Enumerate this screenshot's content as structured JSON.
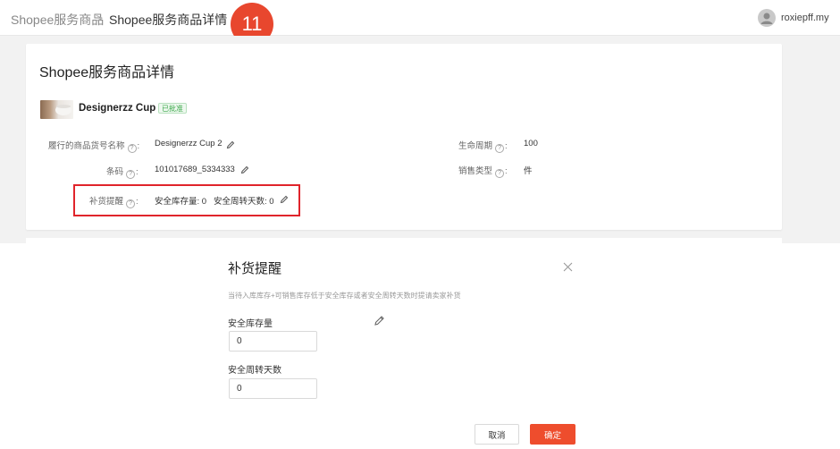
{
  "header": {
    "breadcrumb_root": "Shopee服务商品",
    "breadcrumb_sep": ">",
    "breadcrumb_current": "Shopee服务商品详情",
    "step_number": "11",
    "username": "roxiepff.my"
  },
  "card": {
    "title": "Shopee服务商品详情",
    "product_name": "Designerzz Cup 2",
    "status_badge": "已批准",
    "help_glyph": "?",
    "fields": {
      "sku_label": "履行的商品货号名称",
      "sku_value": "Designerzz Cup 2",
      "barcode_label": "条码",
      "barcode_value": "101017689_5334333",
      "restock_label": "补货提醒",
      "restock_value": "安全库存量: 0   安全周转天数: 0",
      "lifecycle_label": "生命周期",
      "lifecycle_value": "100",
      "sales_type_label": "销售类型",
      "sales_type_value": "件",
      "colon": ":"
    }
  },
  "modal": {
    "title": "补货提醒",
    "description": "当待入库库存+可销售库存低于安全库存或者安全周转天数时提请卖家补货",
    "safety_stock_label": "安全库存量",
    "safety_stock_value": "0",
    "turnover_days_label": "安全周转天数",
    "turnover_days_value": "0",
    "cancel_label": "取消",
    "confirm_label": "确定"
  },
  "colors": {
    "accent": "#ee4d2d",
    "highlight": "#e0242b",
    "approved": "#3aa84a"
  }
}
